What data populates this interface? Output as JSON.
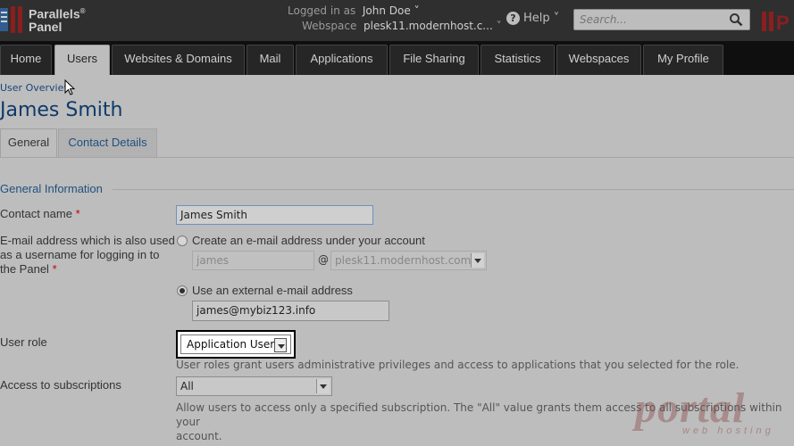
{
  "header": {
    "logo_line1": "Parallels",
    "logo_line2": "Panel",
    "logo_reg": "®",
    "logged_in_prefix": "Logged in as",
    "logged_in_user": "John Doe",
    "webspace_prefix": "Webspace",
    "webspace_value": "plesk11.modernhost.c...",
    "help_label": "Help",
    "search_placeholder": "Search...",
    "colors": {
      "bar": "#2f2f2f",
      "logo_red": "#8a1f1f"
    }
  },
  "tabs": [
    {
      "label": "Home"
    },
    {
      "label": "Users"
    },
    {
      "label": "Websites & Domains"
    },
    {
      "label": "Mail"
    },
    {
      "label": "Applications"
    },
    {
      "label": "File Sharing"
    },
    {
      "label": "Statistics"
    },
    {
      "label": "Webspaces"
    },
    {
      "label": "My Profile"
    }
  ],
  "active_tab": "Users",
  "breadcrumb": "User Overview",
  "page_title": "James Smith",
  "subtabs": [
    {
      "label": "General"
    },
    {
      "label": "Contact Details"
    }
  ],
  "section_title": "General Information",
  "form": {
    "contact_name_label": "Contact name",
    "contact_name_value": "James Smith",
    "email_label_line1": "E-mail address which is also used",
    "email_label_line2": "as a username for logging in to",
    "email_label_line3": "the Panel",
    "radio_create_label": "Create an e-mail address under your account",
    "create_local_value": "james",
    "at_sign": "@",
    "create_domain_value": "plesk11.modernhost.com",
    "radio_external_label": "Use an external e-mail address",
    "external_email_value": "james@mybiz123.info",
    "role_label": "User role",
    "role_value": "Application User",
    "role_hint": "User roles grant users administrative privileges and access to applications that you selected for the role.",
    "subscriptions_label": "Access to subscriptions",
    "subscriptions_value": "All",
    "subscriptions_hint_line1": "Allow users to access only a specified subscription. The \"All\" value grants them access to all subscriptions within your",
    "subscriptions_hint_line2": "account.",
    "required_mark": "*"
  },
  "watermark": {
    "main": "portal",
    "sub": "web hosting"
  }
}
